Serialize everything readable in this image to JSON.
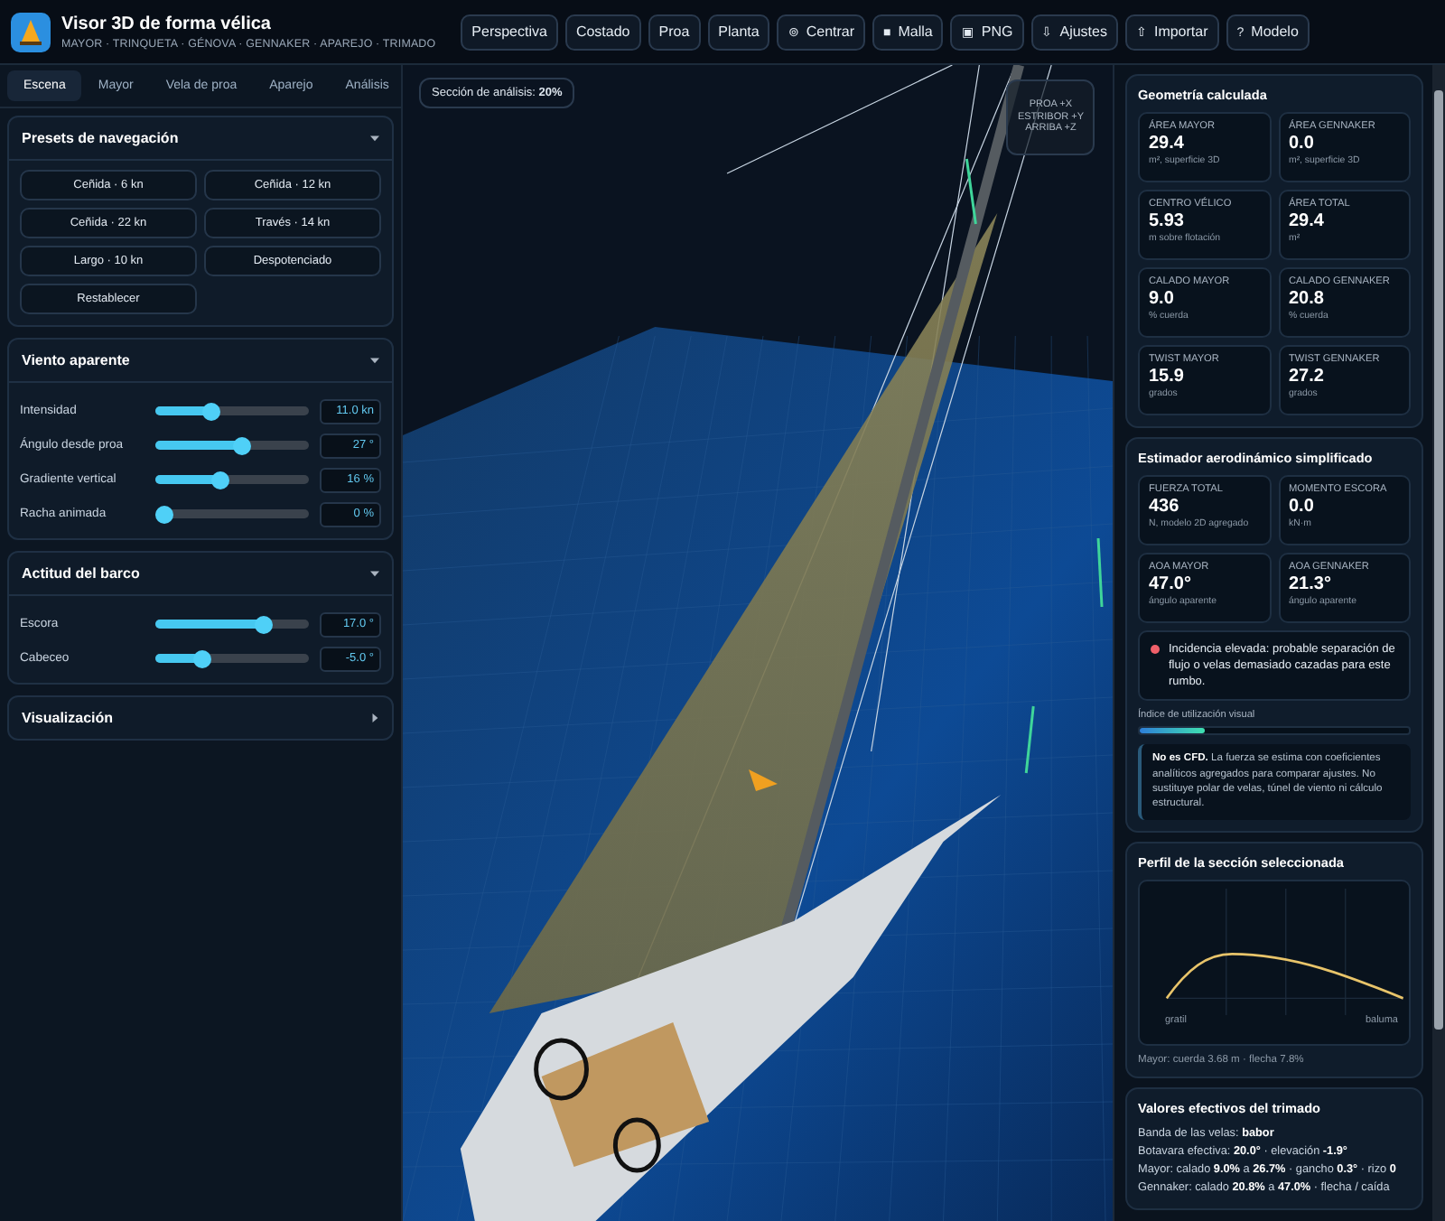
{
  "app": {
    "title": "Visor 3D de forma vélica",
    "subtitle": "MAYOR · TRINQUETA · GÉNOVA · GENNAKER · APAREJO · TRIMADO"
  },
  "toolbar": [
    {
      "label": "Perspectiva"
    },
    {
      "label": "Costado"
    },
    {
      "label": "Proa"
    },
    {
      "label": "Planta"
    },
    {
      "label": "Centrar",
      "icon": "⊚"
    },
    {
      "label": "Malla",
      "icon": "■"
    },
    {
      "label": "PNG",
      "icon": "▣"
    },
    {
      "label": "Ajustes",
      "icon": "⇩"
    },
    {
      "label": "Importar",
      "icon": "⇧"
    },
    {
      "label": "Modelo",
      "icon": "?"
    }
  ],
  "tabs": [
    {
      "label": "Escena",
      "selected": true
    },
    {
      "label": "Mayor",
      "selected": false
    },
    {
      "label": "Vela de proa",
      "selected": false
    },
    {
      "label": "Aparejo",
      "selected": false
    },
    {
      "label": "Análisis",
      "selected": false
    }
  ],
  "sections": [
    {
      "kind": "buttons",
      "title": "Presets de navegación",
      "expanded": true,
      "buttons": [
        "Ceñida · 6 kn",
        "Ceñida · 12 kn",
        "Ceñida · 22 kn",
        "Través · 14 kn",
        "Largo · 10 kn",
        "Despotenciado",
        "Restablecer"
      ]
    },
    {
      "kind": "sliders",
      "title": "Viento aparente",
      "expanded": true,
      "sliders": [
        {
          "label": "Intensidad",
          "level": 0.34,
          "value": "11.0 kn"
        },
        {
          "label": "Ángulo desde proa",
          "level": 0.57,
          "value": "27 °"
        },
        {
          "label": "Gradiente vertical",
          "level": 0.41,
          "value": "16 %"
        },
        {
          "label": "Racha animada",
          "level": 0.0,
          "value": "0 %"
        }
      ]
    },
    {
      "kind": "sliders",
      "title": "Actitud del barco",
      "expanded": true,
      "sliders": [
        {
          "label": "Escora",
          "level": 0.73,
          "value": "17.0 °"
        },
        {
          "label": "Cabeceo",
          "level": 0.28,
          "value": "-5.0 °"
        }
      ]
    },
    {
      "title": "Visualización",
      "expanded": false
    }
  ],
  "viewport": {
    "section_badge": "Sección de análisis: **20%**",
    "axes": [
      "PROA +X",
      "ESTRIBOR +Y",
      "ARRIBA +Z"
    ]
  },
  "geometry": {
    "title": "Geometría calculada",
    "cards": [
      {
        "label": "ÁREA MAYOR",
        "value": "29.4",
        "unit": "m², superficie 3D"
      },
      {
        "label": "ÁREA GENNAKER",
        "value": "0.0",
        "unit": "m², superficie 3D"
      },
      {
        "label": "CENTRO VÉLICO",
        "value": "5.93",
        "unit": "m sobre flotación"
      },
      {
        "label": "ÁREA TOTAL",
        "value": "29.4",
        "unit": "m²"
      },
      {
        "label": "CALADO MAYOR",
        "value": "9.0",
        "unit": "% cuerda"
      },
      {
        "label": "CALADO GENNAKER",
        "value": "20.8",
        "unit": "% cuerda"
      },
      {
        "label": "TWIST MAYOR",
        "value": "15.9",
        "unit": "grados"
      },
      {
        "label": "TWIST GENNAKER",
        "value": "27.2",
        "unit": "grados"
      }
    ]
  },
  "estimator": {
    "title": "Estimador aerodinámico simplificado",
    "cards": [
      {
        "label": "FUERZA TOTAL",
        "value": "436",
        "unit": "N, modelo 2D agregado"
      },
      {
        "label": "MOMENTO ESCORA",
        "value": "0.0",
        "unit": "kN·m"
      },
      {
        "label": "AOA MAYOR",
        "value": "47.0°",
        "unit": "ángulo aparente"
      },
      {
        "label": "AOA GENNAKER",
        "value": "21.3°",
        "unit": "ángulo aparente"
      }
    ],
    "alert": {
      "text": "Incidencia elevada: probable separación de flujo o velas demasiado cazadas para este rumbo.",
      "color": "#f0606a"
    },
    "usage": {
      "label": "Índice de utilización visual",
      "level": 0.24
    },
    "note": "**No es CFD.** La fuerza se estima con coeficientes analíticos agregados para comparar ajustes. No sustituye polar de velas, túnel de viento ni cálculo estructural."
  },
  "profile": {
    "title": "Perfil de la sección seleccionada",
    "left_label": "gratil",
    "right_label": "baluma",
    "caption": "Mayor: cuerda 3.68 m · flecha 7.8%"
  },
  "trim": {
    "title": "Valores efectivos del trimado",
    "lines": [
      "Banda de las velas: **babor**",
      "Botavara efectiva: **20.0°** · elevación **-1.9°**",
      "Mayor: calado **9.0%** a **26.7%** · gancho **0.3°** · rizo **0**",
      "Gennaker: calado **20.8%** a **47.0%** · flecha / caída"
    ]
  }
}
